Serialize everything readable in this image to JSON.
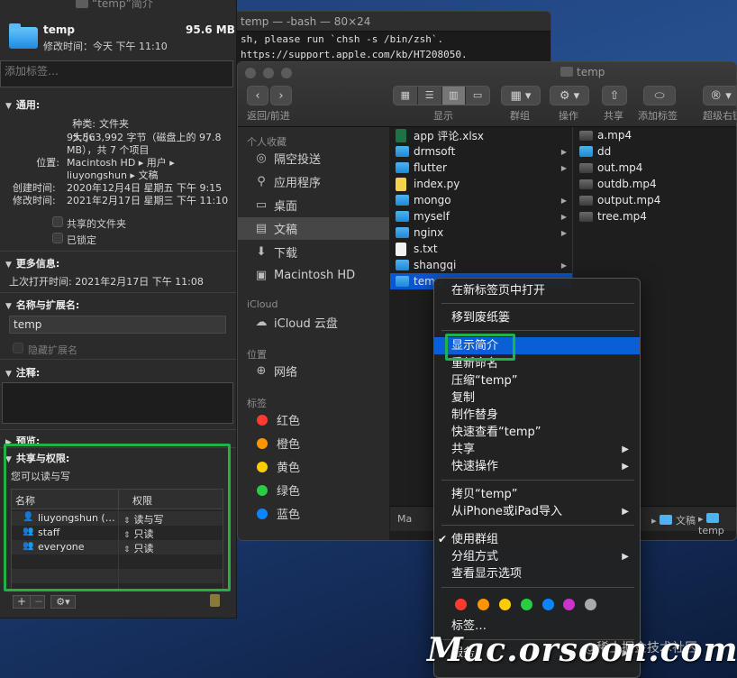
{
  "terminal": {
    "title": "temp — -bash — 80×24",
    "lines": [
      "sh, please run `chsh -s /bin/zsh`.",
      "https://support.apple.com/kb/HT208050."
    ]
  },
  "finder": {
    "title": "temp",
    "toolbar": {
      "back_forward": "返回/前进",
      "view": "显示",
      "group": "群组",
      "action": "操作",
      "share": "共享",
      "add_tag": "添加标签",
      "super_right": "超级右键"
    },
    "sidebar": {
      "favorites_header": "个人收藏",
      "favorites": [
        {
          "label": "隔空投送",
          "icon": "airdrop-icon"
        },
        {
          "label": "应用程序",
          "icon": "applications-icon"
        },
        {
          "label": "桌面",
          "icon": "desktop-icon"
        },
        {
          "label": "文稿",
          "icon": "documents-icon"
        },
        {
          "label": "下载",
          "icon": "downloads-icon"
        },
        {
          "label": "Macintosh HD",
          "icon": "disk-icon"
        }
      ],
      "icloud_header": "iCloud",
      "icloud_drive": "iCloud 云盘",
      "locations_header": "位置",
      "network": "网络",
      "tags_header": "标签",
      "tags": [
        {
          "label": "红色",
          "color": "#ff3b30"
        },
        {
          "label": "橙色",
          "color": "#ff9500"
        },
        {
          "label": "黄色",
          "color": "#ffcc00"
        },
        {
          "label": "绿色",
          "color": "#28cd41"
        },
        {
          "label": "蓝色",
          "color": "#0a84ff"
        }
      ]
    },
    "column1": [
      {
        "name": "app 评论.xlsx",
        "type": "xlsx"
      },
      {
        "name": "drmsoft",
        "type": "folder",
        "has_children": true
      },
      {
        "name": "flutter",
        "type": "folder",
        "has_children": true
      },
      {
        "name": "index.py",
        "type": "py"
      },
      {
        "name": "mongo",
        "type": "folder",
        "has_children": true
      },
      {
        "name": "myself",
        "type": "folder",
        "has_children": true
      },
      {
        "name": "nginx",
        "type": "folder",
        "has_children": true
      },
      {
        "name": "s.txt",
        "type": "txt"
      },
      {
        "name": "shangqi",
        "type": "folder",
        "has_children": true
      },
      {
        "name": "temp",
        "type": "folder",
        "has_children": true,
        "selected": true
      }
    ],
    "column2": [
      {
        "name": "a.mp4",
        "type": "mp4"
      },
      {
        "name": "dd",
        "type": "folder"
      },
      {
        "name": "out.mp4",
        "type": "mp4"
      },
      {
        "name": "outdb.mp4",
        "type": "mp4"
      },
      {
        "name": "output.mp4",
        "type": "mp4"
      },
      {
        "name": "tree.mp4",
        "type": "mp4"
      }
    ],
    "pathbar": {
      "left": "Ma",
      "documents": "文稿",
      "temp": "temp"
    }
  },
  "info": {
    "title": "“temp”简介",
    "name": "temp",
    "size": "95.6 MB",
    "modified_short": "修改时间：今天 下午 11:10",
    "tag_placeholder": "添加标签…",
    "general": {
      "header": "通用:",
      "kind_k": "种类:",
      "kind_v": "文件夹",
      "size_k": "大小:",
      "size_v1": "95,563,992 字节（磁盘上的 97.8",
      "size_v2": "MB），共 7 个项目",
      "where_k": "位置:",
      "where_v1": "Macintosh HD ▸ 用户 ▸",
      "where_v2": "liuyongshun ▸ 文稿",
      "created_k": "创建时间:",
      "created_v": "2020年12月4日 星期五 下午 9:15",
      "modified_k": "修改时间:",
      "modified_v": "2021年2月17日 星期三 下午 11:10",
      "shared_folder": "共享的文件夹",
      "locked": "已锁定"
    },
    "more_info": {
      "header": "更多信息:",
      "last_opened": "上次打开时间:  2021年2月17日 下午 11:08"
    },
    "name_ext": {
      "header": "名称与扩展名:",
      "value": "temp",
      "hide_ext": "隐藏扩展名"
    },
    "comments": {
      "header": "注释:"
    },
    "preview": {
      "header": "预览:"
    },
    "sharing": {
      "header": "共享与权限:",
      "subtitle": "您可以读与写",
      "col_name": "名称",
      "col_priv": "权限",
      "rows": [
        {
          "name": "liuyongshun (…",
          "priv": "读与写",
          "icon": "user-icon"
        },
        {
          "name": "staff",
          "priv": "只读",
          "icon": "group-icon"
        },
        {
          "name": "everyone",
          "priv": "只读",
          "icon": "group-icon"
        }
      ]
    }
  },
  "context_menu": {
    "items": [
      {
        "label": "在新标签页中打开"
      },
      {
        "label": "移到废纸篓"
      },
      {
        "label": "显示简介",
        "highlighted": true
      },
      {
        "label": "重新命名"
      },
      {
        "label": "压缩“temp”"
      },
      {
        "label": "复制"
      },
      {
        "label": "制作替身"
      },
      {
        "label": "快速查看“temp”"
      },
      {
        "label": "共享",
        "submenu": true
      },
      {
        "label": "快速操作",
        "submenu": true
      },
      {
        "label": "拷贝“temp”"
      },
      {
        "label": "从iPhone或iPad导入",
        "submenu": true
      },
      {
        "label": "使用群组",
        "checked": true
      },
      {
        "label": "分组方式",
        "submenu": true
      },
      {
        "label": "查看显示选项"
      },
      {
        "label": "标签…"
      },
      {
        "label": "服务",
        "submenu": true
      }
    ],
    "tag_colors": [
      "#ff3b30",
      "#ff9500",
      "#ffcc00",
      "#28cd41",
      "#0a84ff",
      "#cc33cc",
      "#aaaaaa"
    ]
  },
  "watermark": {
    "main": "Mac.orsoon.com",
    "sub": "@稀土掘金技术社区"
  },
  "colors": {
    "selection": "#0a57d0",
    "menu_highlight": "#0b5fd6",
    "annotation_box": "#1fb24a"
  }
}
